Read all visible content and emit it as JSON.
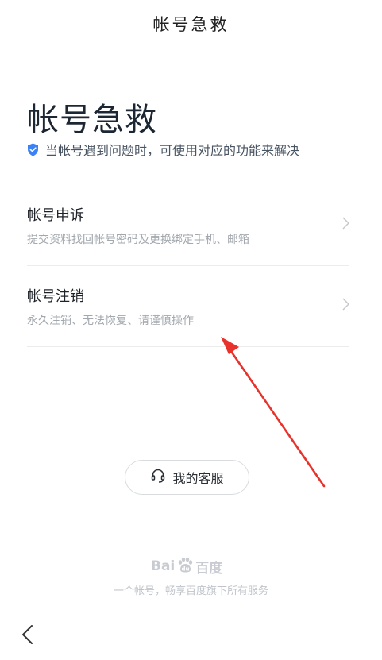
{
  "header": {
    "title": "帐号急救"
  },
  "hero": {
    "title": "帐号急救",
    "subtitle": "当帐号遇到问题时，可使用对应的功能来解决"
  },
  "menu": {
    "items": [
      {
        "label": "帐号申诉",
        "desc": "提交资料找回帐号密码及更换绑定手机、邮箱"
      },
      {
        "label": "帐号注销",
        "desc": "永久注销、无法恢复、请谨慎操作"
      }
    ]
  },
  "service_button": {
    "label": "我的客服",
    "icon": "headset-icon"
  },
  "footer": {
    "logo_left": "Bai",
    "logo_right": "百度",
    "slogan": "一个帐号，畅享百度旗下所有服务"
  },
  "colors": {
    "accent_blue": "#3b82f6",
    "annotation_red": "#e8322c"
  }
}
